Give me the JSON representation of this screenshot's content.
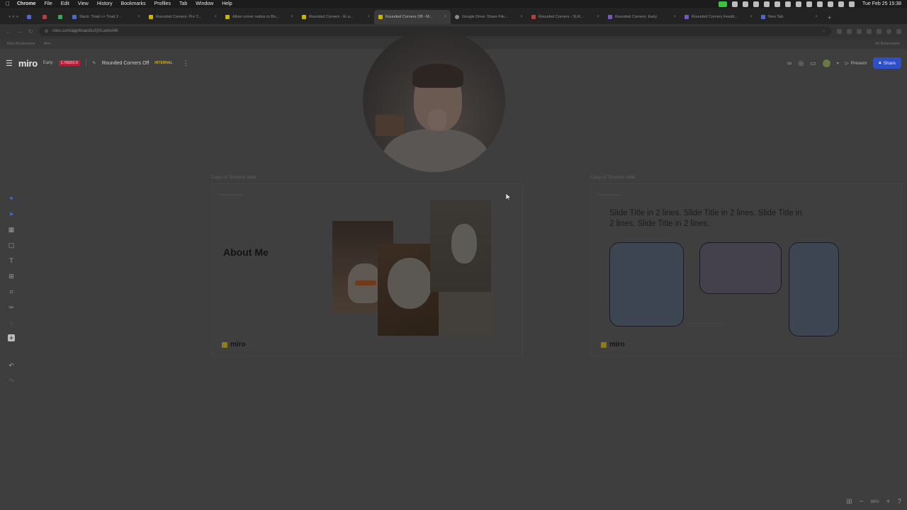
{
  "menubar": {
    "app": "Chrome",
    "items": [
      "File",
      "Edit",
      "View",
      "History",
      "Bookmarks",
      "Profiles",
      "Tab",
      "Window",
      "Help"
    ],
    "clock": "Tue Feb 25  15:38"
  },
  "tabs": [
    {
      "label": "Slack: Triad <> Triad 2 -",
      "icon": "blue"
    },
    {
      "label": "Rounded Corners: Pro T...",
      "icon": "yellow"
    },
    {
      "label": "Allow corner radius to Bo...",
      "icon": "yellow"
    },
    {
      "label": "Rounded Corners - Ei a...",
      "icon": "yellow"
    },
    {
      "label": "Rounded Corners Off - M...",
      "icon": "yellow",
      "active": true
    },
    {
      "label": "Google Drive: Share File...",
      "icon": "grey"
    },
    {
      "label": "Rounded Corners - SLR...",
      "icon": "red"
    },
    {
      "label": "Rounded Corners: Early",
      "icon": "purple"
    },
    {
      "label": "Rounded Corners Feedb...",
      "icon": "purple"
    },
    {
      "label": "New Tab",
      "icon": "blue"
    }
  ],
  "address": {
    "url": "miro.com/app/board/uXjVLukmA4I/"
  },
  "bookmarks": {
    "first": "Miro Bookmarks",
    "second": "Miro",
    "all": "All Bookmarks"
  },
  "miro": {
    "logo": "miro",
    "plan": "Early",
    "plan_badge": "1.76002.0",
    "board_name": "Rounded Corners Off",
    "internal_badge": "INTERNAL",
    "present_label": "Present",
    "share_label": "Share",
    "zoom": "86%"
  },
  "frames": {
    "left": {
      "title": "Copy of Timeline slide",
      "heading": "About Me",
      "logo": "miro"
    },
    "right": {
      "title": "Copy of Timeline slide",
      "heading": "Slide Title in 2 lines. Slide Title in 2 lines. Slide Title in 2 lines. Slide Title in 2 lines.",
      "logo": "miro"
    }
  },
  "colors": {
    "share_button": "#2f4fc7",
    "plan_badge": "#b5213c",
    "shape_blue": "#3d4552",
    "shape_purple": "#45414c"
  }
}
